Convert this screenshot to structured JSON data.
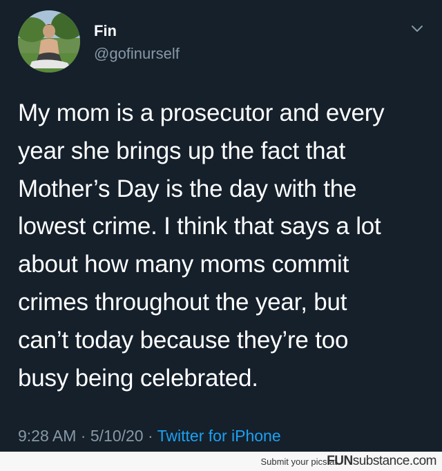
{
  "tweet": {
    "display_name": "Fin",
    "handle": "@gofinurself",
    "text_lines": [
      "My mom is a prosecutor and every",
      "year she brings up the fact that",
      "Mother’s Day is the day with the",
      "lowest crime. I think that says a lot",
      "about how many moms commit",
      "crimes throughout the year, but",
      "can’t today because they’re too",
      "busy being celebrated."
    ],
    "time": "9:28 AM",
    "date": "5/10/20",
    "source": "Twitter for iPhone",
    "separator": "·"
  },
  "footer": {
    "submit_text": "Submit your pics at",
    "brand_fun": "FUN",
    "brand_substance": "substance",
    "brand_tld": ".com"
  },
  "colors": {
    "background": "#15202b",
    "text": "#ffffff",
    "muted": "#8899a6",
    "link": "#1da1f2",
    "footer_bg": "#f7f7f7"
  },
  "icons": {
    "avatar": "profile-photo",
    "chevron": "chevron-down-icon"
  }
}
